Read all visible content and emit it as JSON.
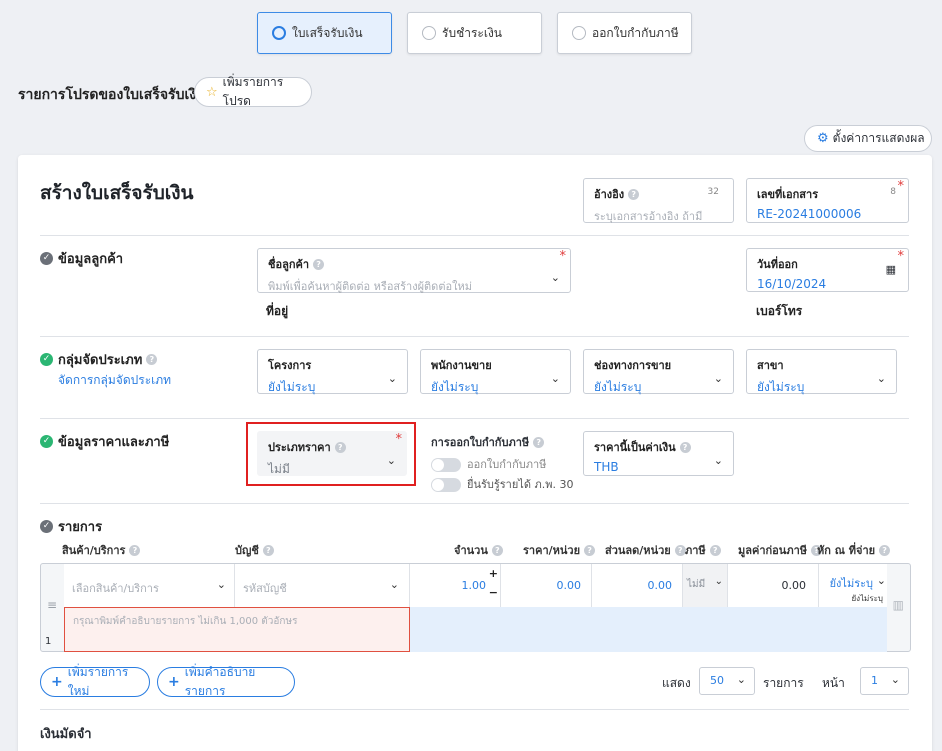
{
  "doc_tabs": [
    {
      "label": "ใบเสร็จรับเงิน",
      "active": true
    },
    {
      "label": "รับชำระเงิน",
      "active": false
    },
    {
      "label": "ออกใบกำกับภาษี",
      "active": false
    }
  ],
  "favorites": {
    "title": "รายการโปรดของใบเสร็จรับเงิน",
    "add_label": "เพิ่มรายการโปรด"
  },
  "display_settings_label": "ตั้งค่าการแสดงผล",
  "page_title": "สร้างใบเสร็จรับเงิน",
  "reference": {
    "label": "อ้างอิง",
    "counter": "32",
    "placeholder": "ระบุเอกสารอ้างอิง ถ้ามี"
  },
  "doc_number": {
    "label": "เลขที่เอกสาร",
    "counter": "8",
    "value": "RE-20241000006"
  },
  "customer_section": {
    "title": "ข้อมูลลูกค้า",
    "customer_name_label": "ชื่อลูกค้า",
    "customer_name_placeholder": "พิมพ์เพื่อค้นหาผู้ติดต่อ หรือสร้างผู้ติดต่อใหม่",
    "address_label": "ที่อยู่",
    "issue_date_label": "วันที่ออก",
    "issue_date_value": "16/10/2024",
    "phone_label": "เบอร์โทร"
  },
  "classification_section": {
    "title": "กลุ่มจัดประเภท",
    "manage_link": "จัดการกลุ่มจัดประเภท",
    "fields": [
      {
        "label": "โครงการ",
        "value": "ยังไม่ระบุ"
      },
      {
        "label": "พนักงานขาย",
        "value": "ยังไม่ระบุ"
      },
      {
        "label": "ช่องทางการขาย",
        "value": "ยังไม่ระบุ"
      },
      {
        "label": "สาขา",
        "value": "ยังไม่ระบุ"
      }
    ]
  },
  "price_tax_section": {
    "title": "ข้อมูลราคาและภาษี",
    "price_type_label": "ประเภทราคา",
    "price_type_value": "ไม่มี",
    "tax_invoice_label": "การออกใบกำกับภาษี",
    "toggle_issue_label": "ออกใบกำกับภาษี",
    "toggle_pp30_label": "ยื่นรับรู้รายได้ ภ.พ. 30",
    "currency_label": "ราคานี้เป็นค่าเงิน",
    "currency_value": "THB"
  },
  "items_section": {
    "title": "รายการ",
    "columns": [
      "สินค้า/บริการ",
      "บัญชี",
      "จำนวน",
      "ราคา/หน่วย",
      "ส่วนลด/หน่วย",
      "ภาษี",
      "มูลค่าก่อนภาษี",
      "หัก ณ ที่จ่าย"
    ],
    "row": {
      "number": "1",
      "product_placeholder": "เลือกสินค้า/บริการ",
      "account_placeholder": "รหัสบัญชี",
      "quantity": "1.00",
      "unit_price": "0.00",
      "discount": "0.00",
      "tax": "ไม่มี",
      "pre_tax_value": "0.00",
      "withholding": "ยังไม่ระบุ",
      "withholding_sub": "ยังไม่ระบุ",
      "description_placeholder": "กรุณาพิมพ์คำอธิบายรายการ ไม่เกิน 1,000 ตัวอักษร"
    },
    "add_item_label": "เพิ่มรายการใหม่",
    "add_description_label": "เพิ่มคำอธิบายรายการ",
    "show_label": "แสดง",
    "page_size": "50",
    "items_label": "รายการ",
    "page_label": "หน้า",
    "page_number": "1"
  },
  "deposit_title": "เงินมัดจำ",
  "colors": {
    "accent": "#2a7de1",
    "error": "#e02020",
    "success": "#2bb673"
  }
}
